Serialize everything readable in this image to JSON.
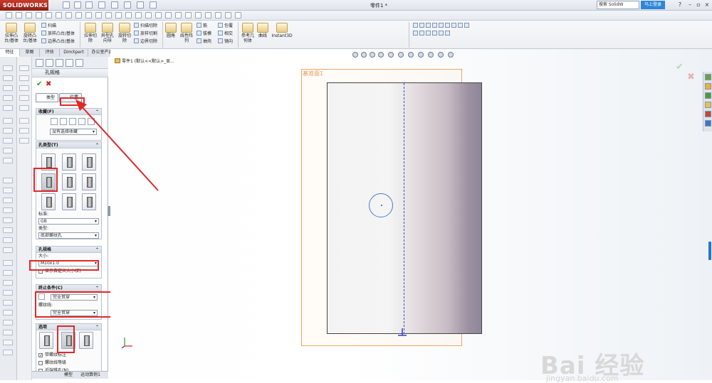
{
  "app": {
    "logo": "SOLIDWORKS",
    "doc_title": "零件1 *",
    "search_placeholder": "搜索 SolidW",
    "login": "马上登录"
  },
  "ribbon": {
    "items": [
      {
        "label": "拉伸凸台/基体"
      },
      {
        "label": "旋转凸台/基体"
      },
      {
        "label": "拉伸切除"
      },
      {
        "label": "异型孔向导"
      },
      {
        "label": "旋转切除"
      },
      {
        "label": "圆角"
      },
      {
        "label": "线性阵列"
      },
      {
        "label": "参考几何体"
      },
      {
        "label": "曲线"
      },
      {
        "label": "Instant3D"
      }
    ],
    "small": [
      "扫描",
      "放样凸台/基体",
      "边界凸台/基体",
      "扫描切除",
      "放样切割",
      "边界切除",
      "筋",
      "拔模",
      "抽壳",
      "包覆",
      "相交",
      "镜向"
    ]
  },
  "tabs": [
    "特征",
    "草图",
    "评估",
    "DimXpert",
    "办公室产品"
  ],
  "property_manager": {
    "title": "孔规格",
    "tab_type": "类型",
    "tab_position": "位置",
    "favorites": {
      "header": "收藏(F)",
      "value": "没有选择收藏"
    },
    "hole_type": {
      "header": "孔类型(T)",
      "standard_label": "标准:",
      "standard": "GB",
      "type_label": "类型:",
      "type": "底部螺纹孔"
    },
    "hole_spec": {
      "header": "孔规格",
      "size_label": "大小:",
      "size": "M10x1.0",
      "custom_label": "显示自定义大小(Z)"
    },
    "end_condition": {
      "header": "终止条件(C)",
      "value": "完全贯穿",
      "thread_label": "螺纹线:",
      "thread_value": "完全贯穿"
    },
    "options": {
      "header": "选项",
      "opt1": "带螺纹标注",
      "opt2": "螺纹线等级",
      "opt3": "近端锥孔(N)"
    }
  },
  "bottom_tabs": [
    "模型",
    "运动算例1"
  ],
  "viewport": {
    "tree_label": "零件1 (默认<<默认>_显...",
    "plane_label": "基准面1"
  },
  "watermark": {
    "brand": "Bai 经验",
    "url": "jingyan.baidu.com"
  }
}
